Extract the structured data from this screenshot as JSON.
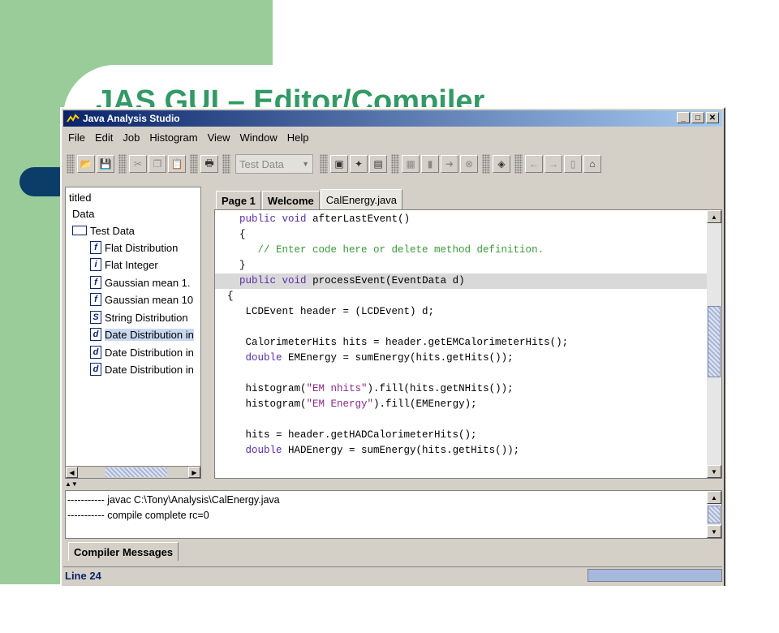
{
  "slide": {
    "title": "JAS GUI – Editor/Compiler"
  },
  "window": {
    "title": "Java Analysis Studio"
  },
  "menu": [
    "File",
    "Edit",
    "Job",
    "Histogram",
    "View",
    "Window",
    "Help"
  ],
  "toolbar": {
    "dataset_selected": "Test Data"
  },
  "tree": {
    "root": "titled",
    "data": "Data",
    "folder": "Test Data",
    "items": [
      {
        "type": "f",
        "label": "Flat Distribution"
      },
      {
        "type": "i",
        "label": "Flat Integer"
      },
      {
        "type": "f",
        "label": "Gaussian mean 1."
      },
      {
        "type": "f",
        "label": "Gaussian mean 10"
      },
      {
        "type": "S",
        "label": "String Distribution"
      },
      {
        "type": "d",
        "label": "Date Distribution in"
      },
      {
        "type": "d",
        "label": "Date Distribution in"
      },
      {
        "type": "d",
        "label": "Date Distribution in"
      }
    ]
  },
  "tabs": [
    "Page 1",
    "Welcome",
    "CalEnergy.java"
  ],
  "code": [
    "    public void afterLastEvent()",
    "    {",
    "       // Enter code here or delete method definition.",
    "    }",
    "    public void processEvent(EventData d)",
    "  {",
    "     LCDEvent header = (LCDEvent) d;",
    "",
    "     CalorimeterHits hits = header.getEMCalorimeterHits();",
    "     double EMEnergy = sumEnergy(hits.getHits());",
    "",
    "     histogram(\"EM nhits\").fill(hits.getNHits());",
    "     histogram(\"EM Energy\").fill(EMEnergy);",
    "",
    "     hits = header.getHADCalorimeterHits();",
    "     double HADEnergy = sumEnergy(hits.getHits());"
  ],
  "messages": [
    "----------- javac C:\\Tony\\Analysis\\CalEnergy.java",
    "----------- compile complete rc=0"
  ],
  "bottom_tab": "Compiler Messages",
  "status": "Line 24",
  "colors": {
    "keyword": "#5a2da8",
    "comment": "#3a9a3a",
    "string": "#8a2a8a",
    "title_green": "#339966"
  }
}
